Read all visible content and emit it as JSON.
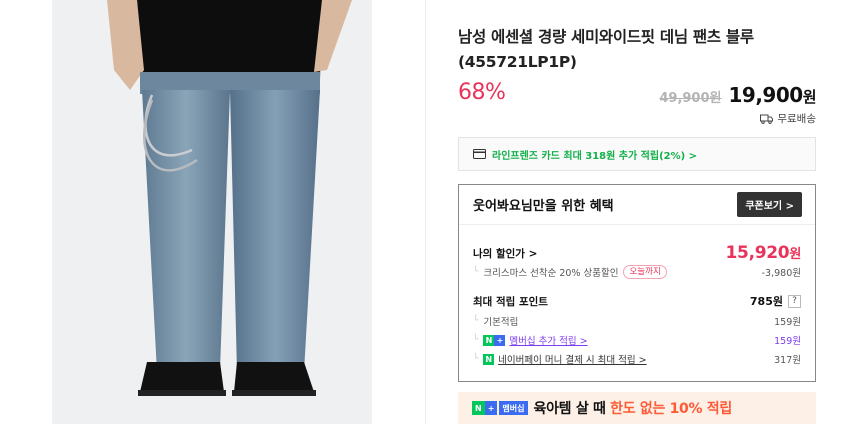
{
  "product": {
    "title": "남성 에센셜 경량 세미와이드핏 데님 팬츠 블루 (455721LP1P)",
    "discount": "68%",
    "original_price": "49,900원",
    "final_price": "19,900",
    "currency": "원",
    "shipping": "무료배송"
  },
  "card_promo": {
    "text": "라인프렌즈 카드 최대 318원 추가 적립(2%) >"
  },
  "benefits": {
    "title": "웃어봐요님만을 위한 혜택",
    "coupon_button": "쿠폰보기 >",
    "my_discount_label": "나의 할인가 >",
    "my_price": "15,920",
    "my_price_unit": "원",
    "christmas_label": "크리스마스 선착순 20% 상품할인",
    "today_badge": "오늘까지",
    "christmas_amount": "-3,980원",
    "max_points_label": "최대 적립 포인트",
    "max_points_value": "785원",
    "help_icon": "?",
    "basic_label": "기본적립",
    "basic_value": "159원",
    "membership_label": "멤버십 추가 적립 >",
    "membership_value": "159원",
    "npay_label": "네이버페이 머니 결제 시 최대 적립 >",
    "npay_value": "317원"
  },
  "banner": {
    "tag1": "N",
    "tag2": "+",
    "tag3": "멤버십",
    "text_main": "육아템 살 때 ",
    "text_highlight": "한도 없는 10% 적립"
  },
  "colors": {
    "discount": "#e8345a",
    "npay_green": "#03c75a",
    "membership_purple": "#7d3cf0",
    "banner_bg": "#fdf0e6",
    "banner_highlight": "#ff5a36"
  },
  "icons": [
    "truck-icon",
    "credit-card-icon",
    "chevron-right-icon",
    "question-icon",
    "npay-logo-icon",
    "naver-plus-icon"
  ]
}
